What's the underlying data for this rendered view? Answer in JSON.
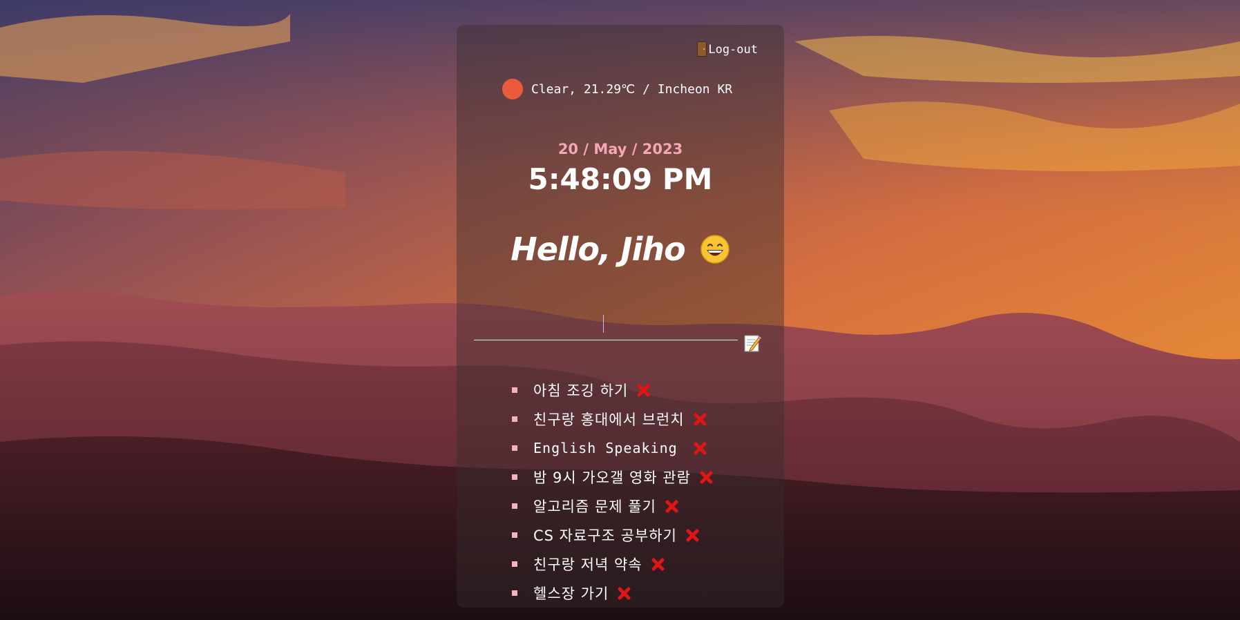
{
  "header": {
    "logout_label": "Log-out"
  },
  "weather": {
    "text": "Clear, 21.29℃ / Incheon KR",
    "icon": "sun-icon",
    "icon_color": "#ea5b3e"
  },
  "datetime": {
    "date": "20 / May / 2023",
    "time": "5:48:09 PM"
  },
  "greeting": {
    "text": "Hello, Jiho",
    "emoji": "grinning-face-icon"
  },
  "todo_form": {
    "input_value": "",
    "submit_icon": "memo-icon"
  },
  "todos": [
    {
      "text": "아침 조깅 하기"
    },
    {
      "text": "친구랑 홍대에서 브런치"
    },
    {
      "text": "English Speaking "
    },
    {
      "text": "밤 9시 가오갤 영화 관람"
    },
    {
      "text": "알고리즘 문제 풀기"
    },
    {
      "text": "CS 자료구조 공부하기"
    },
    {
      "text": "친구랑 저녁 약속"
    },
    {
      "text": "헬스장 가기"
    }
  ],
  "colors": {
    "date": "#f4a7b6",
    "bullet": "#f4b3c0",
    "delete": "#e01515"
  }
}
